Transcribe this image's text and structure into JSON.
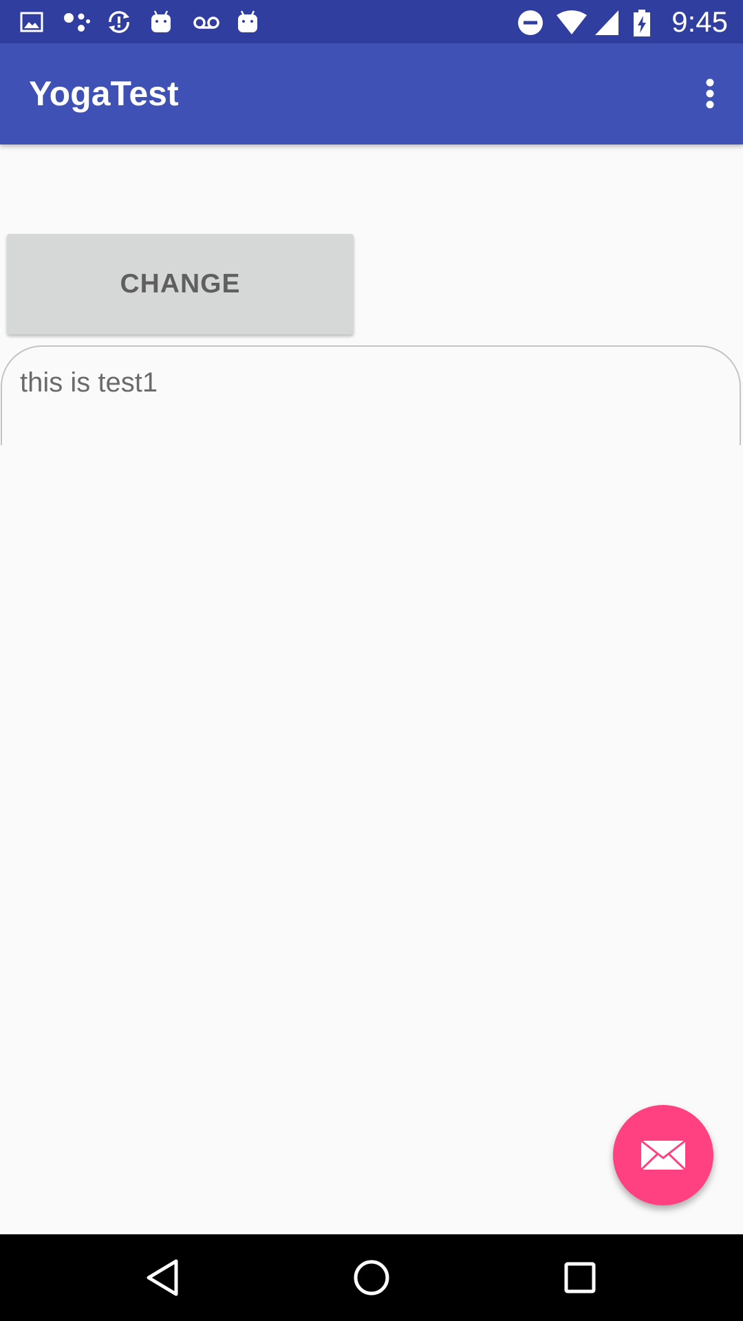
{
  "status_bar": {
    "time": "9:45",
    "left_icons": [
      "image-icon",
      "connection-icon",
      "sync-icon",
      "android-icon",
      "voicemail-icon",
      "android-icon"
    ],
    "right_icons": [
      "do-not-disturb-icon",
      "wifi-icon",
      "cell-signal-icon",
      "battery-charging-icon"
    ]
  },
  "app_bar": {
    "title": "YogaTest",
    "overflow_icon": "more-vert-icon"
  },
  "main": {
    "change_button_label": "CHANGE",
    "text_area_value": "this is test1"
  },
  "fab": {
    "icon": "email-icon"
  },
  "nav_bar": {
    "buttons": [
      "back-icon",
      "home-icon",
      "recents-icon"
    ]
  },
  "colors": {
    "status_bar": "#303f9f",
    "app_bar": "#3f51b5",
    "accent": "#ff4081",
    "background": "#fafafa",
    "button": "#d6d7d7"
  }
}
